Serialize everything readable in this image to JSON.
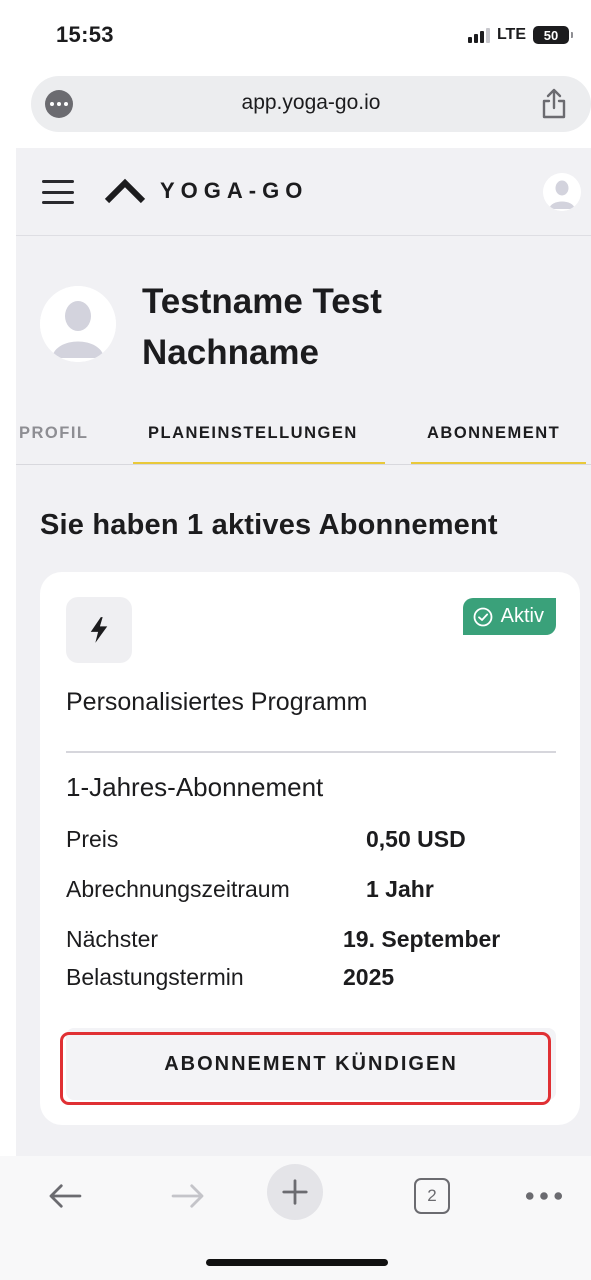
{
  "status_bar": {
    "time": "15:53",
    "network": "LTE",
    "battery": "50",
    "signal_bars_active": 3,
    "signal_bars_total": 4
  },
  "browser": {
    "url": "app.yoga-go.io",
    "menu_icon": "ellipsis-circle-icon",
    "share_icon": "share-icon"
  },
  "app_header": {
    "menu_icon": "hamburger-icon",
    "logo_text": "YOGA-GO",
    "avatar_icon": "user-avatar-icon"
  },
  "profile": {
    "name": "Testname Test Nachname"
  },
  "tabs": [
    {
      "label": "PROFIL",
      "active": false
    },
    {
      "label": "PLANEINSTELLUNGEN",
      "active": false
    },
    {
      "label": "ABONNEMENT",
      "active": true
    }
  ],
  "subscriptions": {
    "section_title": "Sie haben 1 aktives Abonnement",
    "card": {
      "icon": "lightning-icon",
      "status_badge": "Aktiv",
      "status_color": "#3aa17a",
      "plan_name": "Personalisiertes Programm",
      "subscription_type": "1-Jahres-Abonnement",
      "rows": [
        {
          "label": "Preis",
          "value": "0,50 USD"
        },
        {
          "label": "Abrechnungszeitraum",
          "value": "1 Jahr"
        },
        {
          "label": "Nächster Belastungstermin",
          "value": "19. September 2025"
        }
      ],
      "cancel_label": "ABONNEMENT KÜNDIGEN",
      "highlight_color": "#e03034"
    }
  },
  "toolbar": {
    "back_icon": "arrow-left-icon",
    "forward_icon": "arrow-right-icon",
    "new_tab_icon": "plus-icon",
    "tab_count": "2",
    "more_icon": "more-dots-icon"
  }
}
